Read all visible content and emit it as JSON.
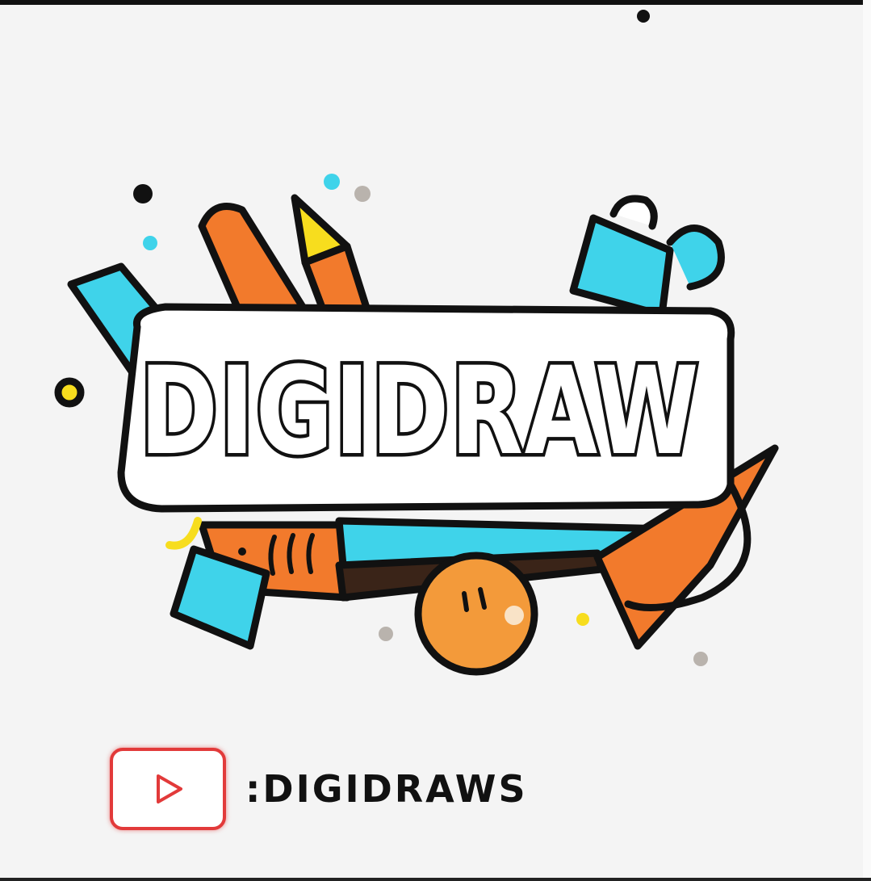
{
  "logo": {
    "wordmark": "DIGIDRAW",
    "colors": {
      "outline": "#111111",
      "cyan": "#3fd3ea",
      "orange": "#f27a2c",
      "yellow": "#f7dd1e",
      "fill_white": "#ffffff",
      "dot_gray": "#b9b3ad"
    }
  },
  "channel": {
    "icon": "play-button-icon",
    "name": ":DIGIDRAWS",
    "accent": "#e23a3a"
  }
}
